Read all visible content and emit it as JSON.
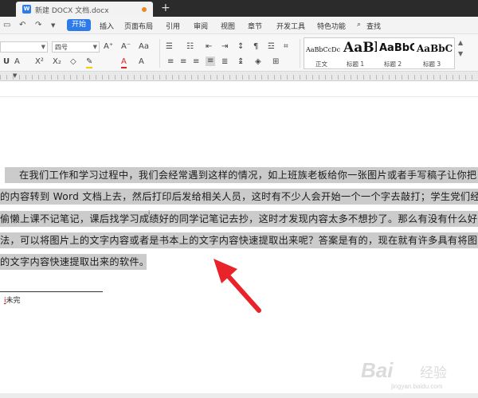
{
  "titlebar": {
    "doc_tab_title": "新建 DOCX 文档.docx",
    "logo_letter": "W",
    "new_tab_symbol": "+",
    "accent": "#2d7be8"
  },
  "menubar": {
    "start": "开始",
    "items": [
      "插入",
      "页面布局",
      "引用",
      "审阅",
      "视图",
      "章节",
      "开发工具",
      "特色功能"
    ],
    "search": "查找",
    "quick_access": [
      "undo-icon",
      "redo-icon",
      "dropdown-icon"
    ]
  },
  "toolbar": {
    "font_size": "四号",
    "styles": [
      {
        "preview": "AaBbCcDc",
        "name": "正文"
      },
      {
        "preview": "AaBl",
        "name": "标题 1"
      },
      {
        "preview": "AaBbC",
        "name": "标题 2"
      },
      {
        "preview": "AaBbC",
        "name": "标题 3"
      }
    ]
  },
  "document": {
    "lines": [
      "在我们工作和学习过程中，我们会经常遇到这样的情况，如上班族老板给你一张图片或者手写稿子让你把",
      "的内容转到 Word 文档上去，然后打印后发给相关人员，这时有不少人会开始一个一个字去敲打；学生党们经",
      "偷懒上课不记笔记，课后找学习成绩好的同学记笔记去抄，这时才发现内容太多不想抄了。那么有没有什么好",
      "法，可以将图片上的文字内容或者是书本上的文字内容快速提取出来呢？答案是有的，现在就有许多具有将图",
      "的文字内容快速提取出来的软件。"
    ],
    "footnote_ref": "i",
    "footnote_mark": "i",
    "footnote_text": "未完",
    "highlight_color": "#cbcbcb"
  },
  "watermark": {
    "brand": "Bai",
    "brand_tail": "经验",
    "url": "jingyan.baidu.com"
  }
}
